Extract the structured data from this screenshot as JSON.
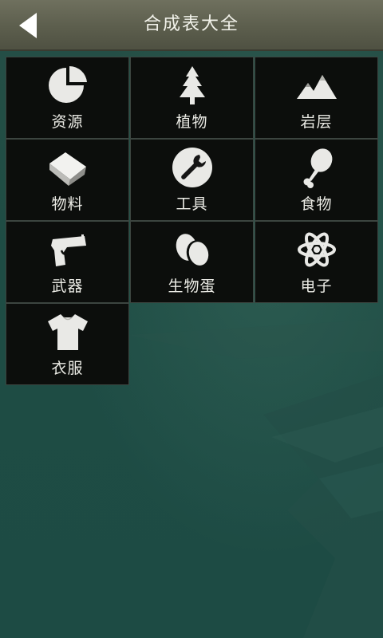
{
  "header": {
    "title": "合成表大全",
    "back_icon": "back-arrow-icon"
  },
  "categories": [
    {
      "label": "资源",
      "icon": "pie-chart-icon"
    },
    {
      "label": "植物",
      "icon": "pine-tree-icon"
    },
    {
      "label": "岩层",
      "icon": "mountain-icon"
    },
    {
      "label": "物料",
      "icon": "cube-icon"
    },
    {
      "label": "工具",
      "icon": "wrench-icon"
    },
    {
      "label": "食物",
      "icon": "drumstick-icon"
    },
    {
      "label": "武器",
      "icon": "pistol-icon"
    },
    {
      "label": "生物蛋",
      "icon": "eggs-icon"
    },
    {
      "label": "电子",
      "icon": "atom-icon"
    },
    {
      "label": "衣服",
      "icon": "tshirt-icon"
    }
  ],
  "colors": {
    "header": "#5f604f",
    "cell": "#0c0e0c",
    "background": "#1f4f47",
    "icon": "#ececec"
  }
}
